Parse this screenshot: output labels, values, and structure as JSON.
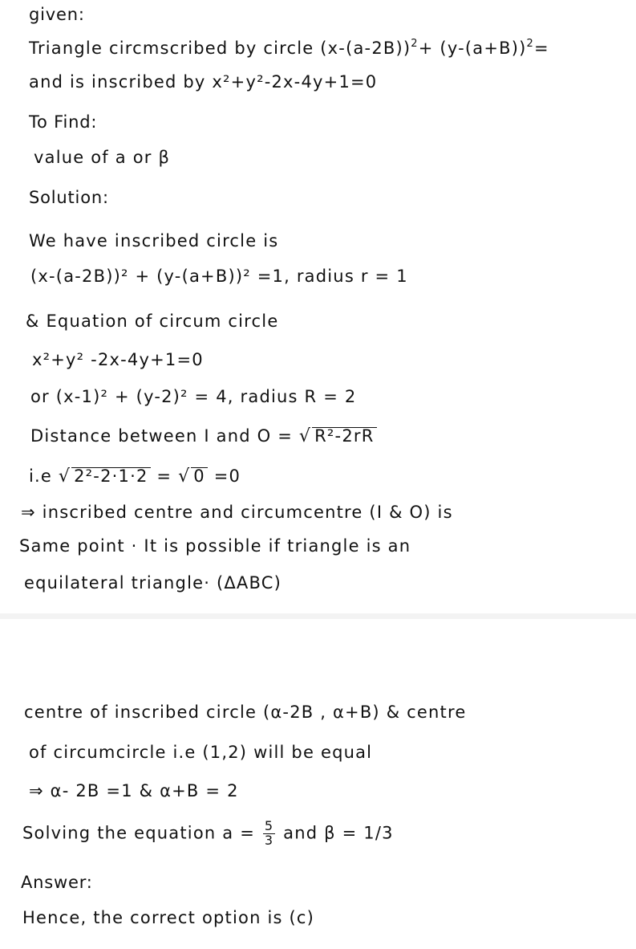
{
  "page1": {
    "given_heading": "given:",
    "given_line1_text": "Triangle circmscribed by circle ",
    "given_line1_eq_a": "(x-(a-2B))",
    "given_line1_eq_b": "+ (y-(a+B))",
    "given_line1_eq_end": "=",
    "exponent": "2",
    "given_line2_text": "and  is inscribed  by ",
    "given_line2_eq": "x²+y²-2x-4y+1=0",
    "to_find_heading": "To Find:",
    "to_find_text": "value of a or β",
    "solution_heading": "Solution:",
    "sol_line1": "We have inscribed circle is",
    "sol_line2_eq": "(x-(a-2B))² + (y-(a+B))² =1",
    "sol_line2_radius": ", radius r = 1",
    "sol_line3": "& Equation of circum circle",
    "sol_line4": "x²+y² -2x-4y+1=0",
    "sol_line5_eq": "or  (x-1)² + (y-2)² = 4",
    "sol_line5_radius": ", radius R = 2",
    "sol_line6_text": "Distance between  I  and  O = ",
    "sol_line6_sqrt": "R²-2rR",
    "sol_line7_prefix": "i.e ",
    "sol_line7_sqrt": "2²-2·1·2",
    "sol_line7_mid": " =  ",
    "sol_line7_sqrt2": "0",
    "sol_line7_end": " =0",
    "sol_line8": "⇒ inscribed centre and circumcentre (I & O) is",
    "sol_line9": "Same point · It is possible if triangle is an",
    "sol_line10": "equilateral triangle· (ΔABC)"
  },
  "page2": {
    "line1": "centre of inscribed circle  (α-2B , α+B) & centre",
    "line2": "of circumcircle  i.e  (1,2) will be equal",
    "line3": "⇒   α- 2B =1   &  α+B = 2",
    "line4_text": "Solving the equation   a = ",
    "line4_frac_num": "5",
    "line4_frac_den": "3",
    "line4_end": " and  β = 1/3",
    "answer_heading": "Answer:",
    "answer_text": "Hence, the correct option is  (c)"
  }
}
